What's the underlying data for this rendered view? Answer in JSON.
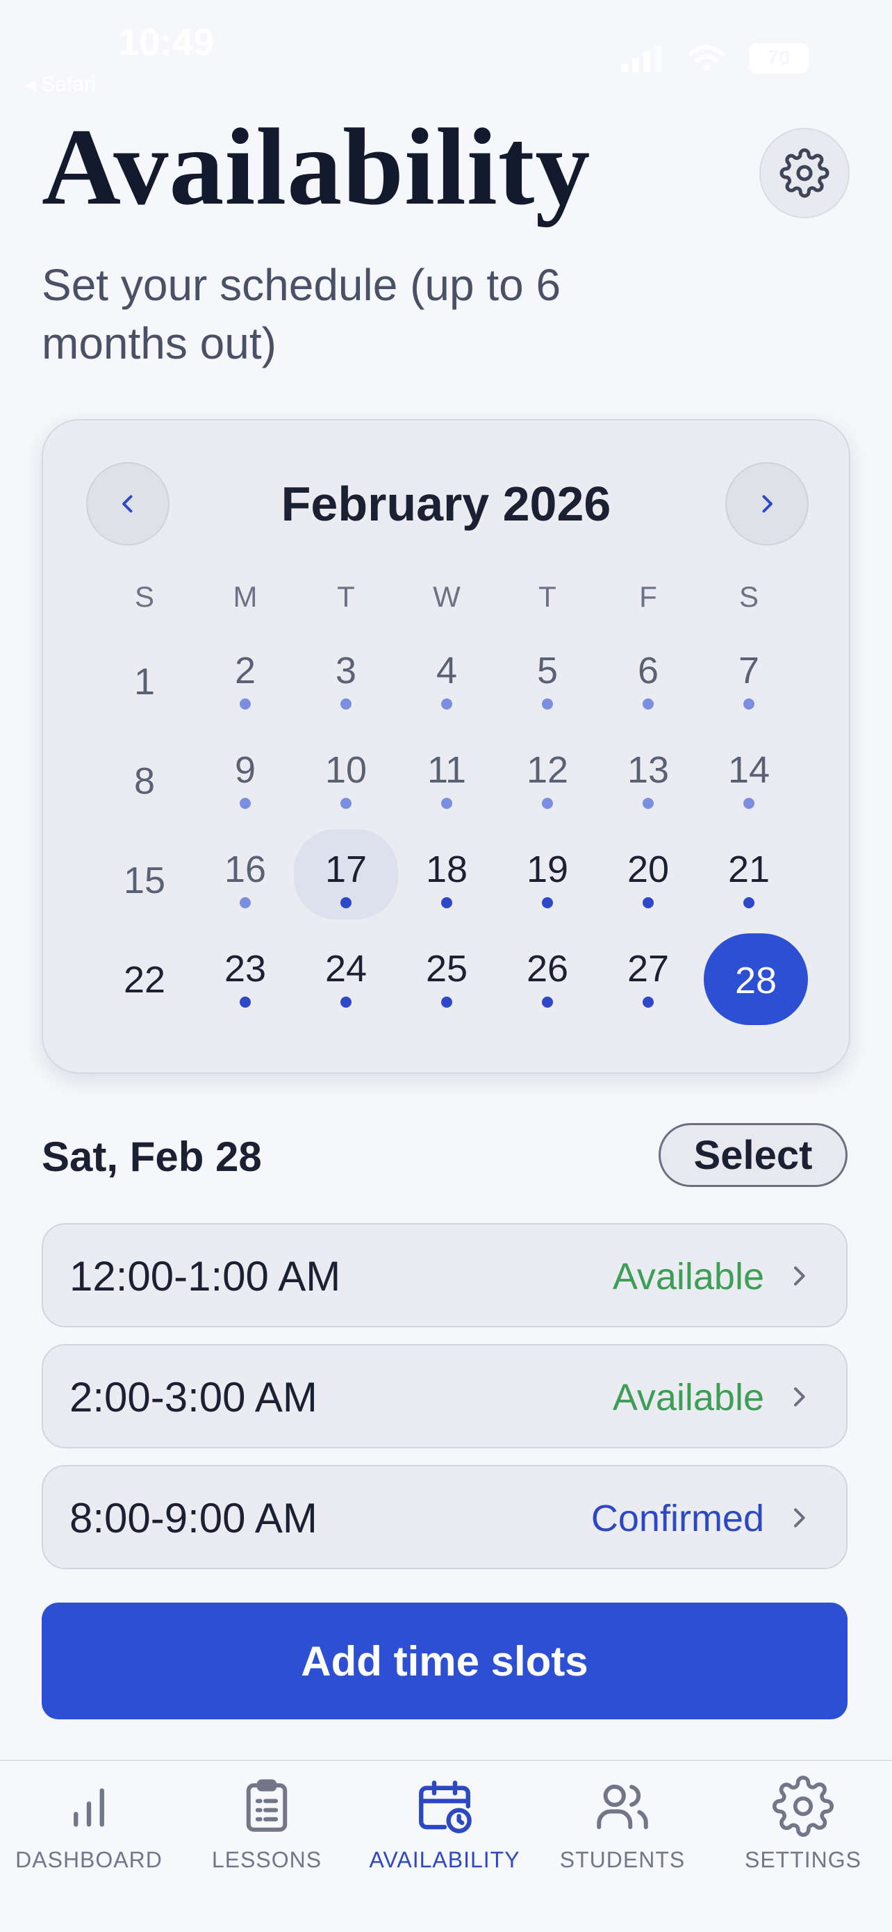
{
  "status_bar": {
    "time": "10:49",
    "back_label": "◂ Safari",
    "battery": "70"
  },
  "header": {
    "title": "Availability",
    "subtitle": "Set your schedule (up to 6 months out)"
  },
  "calendar": {
    "month_label": "February 2026",
    "weekdays": [
      "S",
      "M",
      "T",
      "W",
      "T",
      "F",
      "S"
    ],
    "weeks": [
      [
        "1",
        "2",
        "3",
        "4",
        "5",
        "6",
        "7"
      ],
      [
        "8",
        "9",
        "10",
        "11",
        "12",
        "13",
        "14"
      ],
      [
        "15",
        "16",
        "17",
        "18",
        "19",
        "20",
        "21"
      ],
      [
        "22",
        "23",
        "24",
        "25",
        "26",
        "27",
        "28"
      ]
    ],
    "today": "17",
    "selected": "28"
  },
  "selected_date": {
    "label": "Sat, Feb 28",
    "select_label": "Select"
  },
  "slots": [
    {
      "time": "12:00-1:00 AM",
      "status": "Available"
    },
    {
      "time": "2:00-3:00 AM",
      "status": "Available"
    },
    {
      "time": "8:00-9:00 AM",
      "status": "Confirmed"
    }
  ],
  "add_button": "Add time slots",
  "tabs": [
    {
      "label": "DASHBOARD",
      "icon": "chart-bar-icon"
    },
    {
      "label": "LESSONS",
      "icon": "clipboard-icon"
    },
    {
      "label": "AVAILABILITY",
      "icon": "calendar-clock-icon",
      "active": true
    },
    {
      "label": "STUDENTS",
      "icon": "users-icon"
    },
    {
      "label": "SETTINGS",
      "icon": "gear-icon"
    }
  ],
  "colors": {
    "accent": "#2d4fd3",
    "available": "#3e9e55",
    "confirmed": "#2c48c2",
    "background": "#f6f7fa"
  }
}
